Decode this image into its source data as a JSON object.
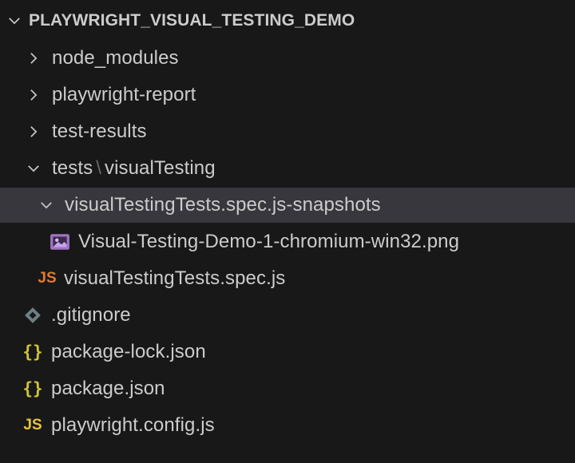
{
  "explorer": {
    "root": {
      "label": "PLAYWRIGHT_VISUAL_TESTING_DEMO"
    },
    "items": [
      {
        "label": "node_modules",
        "type": "folder",
        "expanded": false,
        "icon": "chevron-right-icon"
      },
      {
        "label": "playwright-report",
        "type": "folder",
        "expanded": false,
        "icon": "chevron-right-icon"
      },
      {
        "label": "test-results",
        "type": "folder",
        "expanded": false,
        "icon": "chevron-right-icon"
      },
      {
        "label_part1": "tests",
        "separator": "\\",
        "label_part2": "visualTesting",
        "type": "folder",
        "expanded": true,
        "icon": "chevron-down-icon"
      },
      {
        "label": "visualTestingTests.spec.js-snapshots",
        "type": "folder",
        "expanded": true,
        "selected": true,
        "icon": "chevron-down-icon"
      },
      {
        "label": "Visual-Testing-Demo-1-chromium-win32.png",
        "type": "file",
        "icon": "image-file-icon"
      },
      {
        "label": "visualTestingTests.spec.js",
        "type": "file",
        "icon_text": "JS",
        "icon": "javascript-file-icon"
      },
      {
        "label": ".gitignore",
        "type": "file",
        "icon": "git-diamond-icon"
      },
      {
        "label": "package-lock.json",
        "type": "file",
        "icon_text": "{}",
        "icon": "json-file-icon"
      },
      {
        "label": "package.json",
        "type": "file",
        "icon_text": "{}",
        "icon": "json-file-icon"
      },
      {
        "label": "playwright.config.js",
        "type": "file",
        "icon_text": "JS",
        "icon": "javascript-file-icon"
      }
    ]
  },
  "colors": {
    "background": "#181818",
    "selected_row": "#37373d",
    "text": "#cccccc",
    "js_orange": "#e37933",
    "js_yellow": "#e8c43a",
    "json_yellow": "#d3c33b",
    "image_purple": "#a074c4",
    "git_gray": "#6d8086"
  }
}
